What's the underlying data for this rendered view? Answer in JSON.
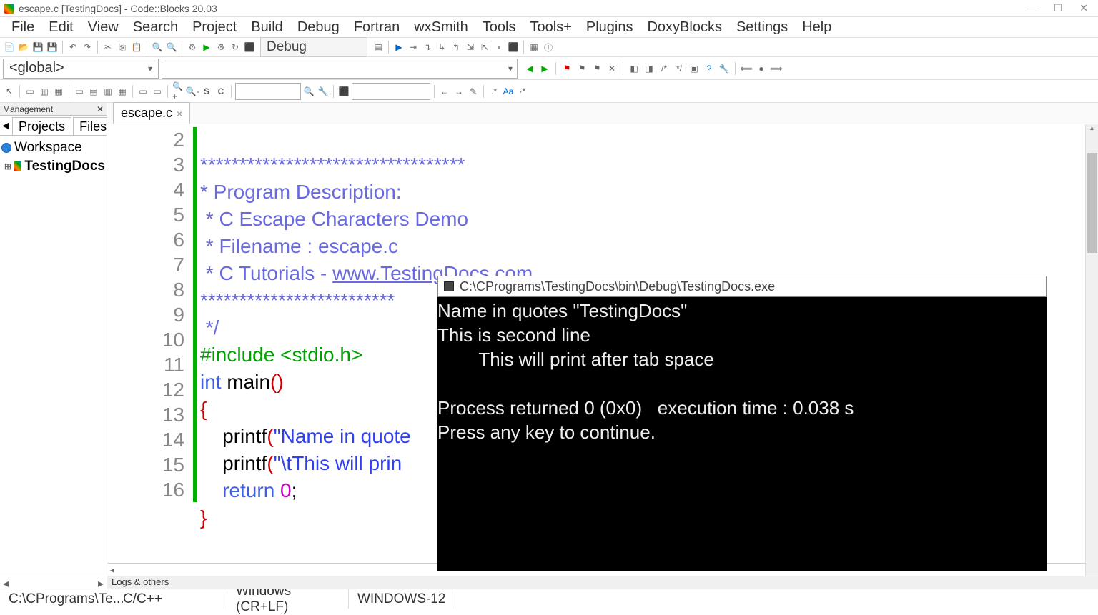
{
  "title": "escape.c [TestingDocs] - Code::Blocks 20.03",
  "menus": [
    "File",
    "Edit",
    "View",
    "Search",
    "Project",
    "Build",
    "Debug",
    "Fortran",
    "wxSmith",
    "Tools",
    "Tools+",
    "Plugins",
    "DoxyBlocks",
    "Settings",
    "Help"
  ],
  "build_config": "Debug",
  "scope": "<global>",
  "management": {
    "title": "Management",
    "tabs": [
      "Projects",
      "Files"
    ],
    "workspace": "Workspace",
    "project": "TestingDocs"
  },
  "file_tab": "escape.c",
  "code": {
    "lines": [
      "2",
      "3",
      "4",
      "5",
      "6",
      "7",
      "8",
      "9",
      "10",
      "11",
      "12",
      "13",
      "14",
      "15",
      "16"
    ],
    "l2": "**********************************",
    "l3": "* Program Description:",
    "l4": " * C Escape Characters Demo",
    "l5": " * Filename : escape.c",
    "l6_a": " * C Tutorials - ",
    "l6_b": "www.TestingDocs.com",
    "l7": "*************************",
    "l8": " */",
    "l9_a": "#include ",
    "l9_b": "<stdio.h>",
    "l10_a": "int",
    "l10_b": " main",
    "l10_c": "()",
    "l11": "{",
    "l12_a": "    printf",
    "l12_b": "(",
    "l12_c": "\"Name in quote",
    "l13_a": "    printf",
    "l13_b": "(",
    "l13_c": "\"\\tThis will prin",
    "l14_a": "    return",
    "l14_b": " 0",
    "l14_c": ";",
    "l15": "}"
  },
  "console": {
    "title": "C:\\CPrograms\\TestingDocs\\bin\\Debug\\TestingDocs.exe",
    "l1": "Name in quotes \"TestingDocs\"",
    "l2": "This is second line",
    "l3": "        This will print after tab space",
    "l4": "",
    "l5": "Process returned 0 (0x0)   execution time : 0.038 s",
    "l6": "Press any key to continue."
  },
  "logs_label": "Logs & others",
  "status": {
    "path": "C:\\CPrograms\\Te...",
    "lang": "C/C++",
    "eol": "Windows (CR+LF)",
    "enc": "WINDOWS-12"
  }
}
